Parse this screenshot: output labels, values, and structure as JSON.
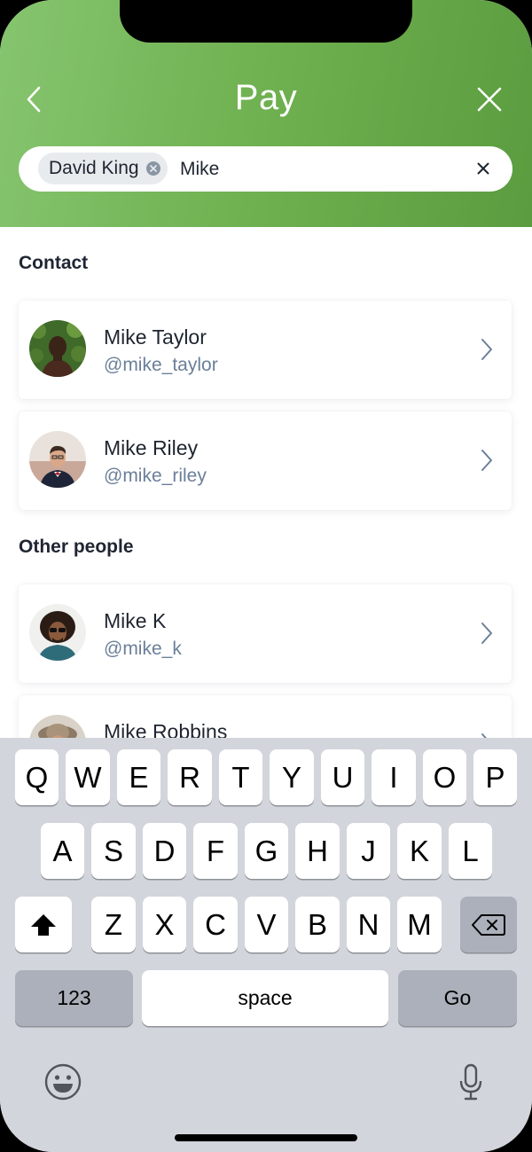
{
  "header": {
    "title": "Pay",
    "back_icon": "chevron-left-icon",
    "close_icon": "close-icon",
    "gradient": [
      "#86c56f",
      "#5a9c3f"
    ]
  },
  "search": {
    "chip_label": "David King",
    "query": "Mike",
    "clear_icon": "close-icon"
  },
  "sections": {
    "contact_title": "Contact",
    "other_title": "Other people"
  },
  "contacts": [
    {
      "name": "Mike Taylor",
      "handle": "@mike_taylor"
    },
    {
      "name": "Mike Riley",
      "handle": "@mike_riley"
    }
  ],
  "others": [
    {
      "name": "Mike K",
      "handle": "@mike_k"
    },
    {
      "name": "Mike Robbins",
      "handle": ""
    }
  ],
  "keyboard": {
    "row1": [
      "Q",
      "W",
      "E",
      "R",
      "T",
      "Y",
      "U",
      "I",
      "O",
      "P"
    ],
    "row2": [
      "A",
      "S",
      "D",
      "F",
      "G",
      "H",
      "J",
      "K",
      "L"
    ],
    "row3": [
      "Z",
      "X",
      "C",
      "V",
      "B",
      "N",
      "M"
    ],
    "numbers_label": "123",
    "space_label": "space",
    "go_label": "Go"
  },
  "colors": {
    "name": "#1e2530",
    "handle": "#6b7f99",
    "keyboard_bg": "#d2d5db"
  }
}
